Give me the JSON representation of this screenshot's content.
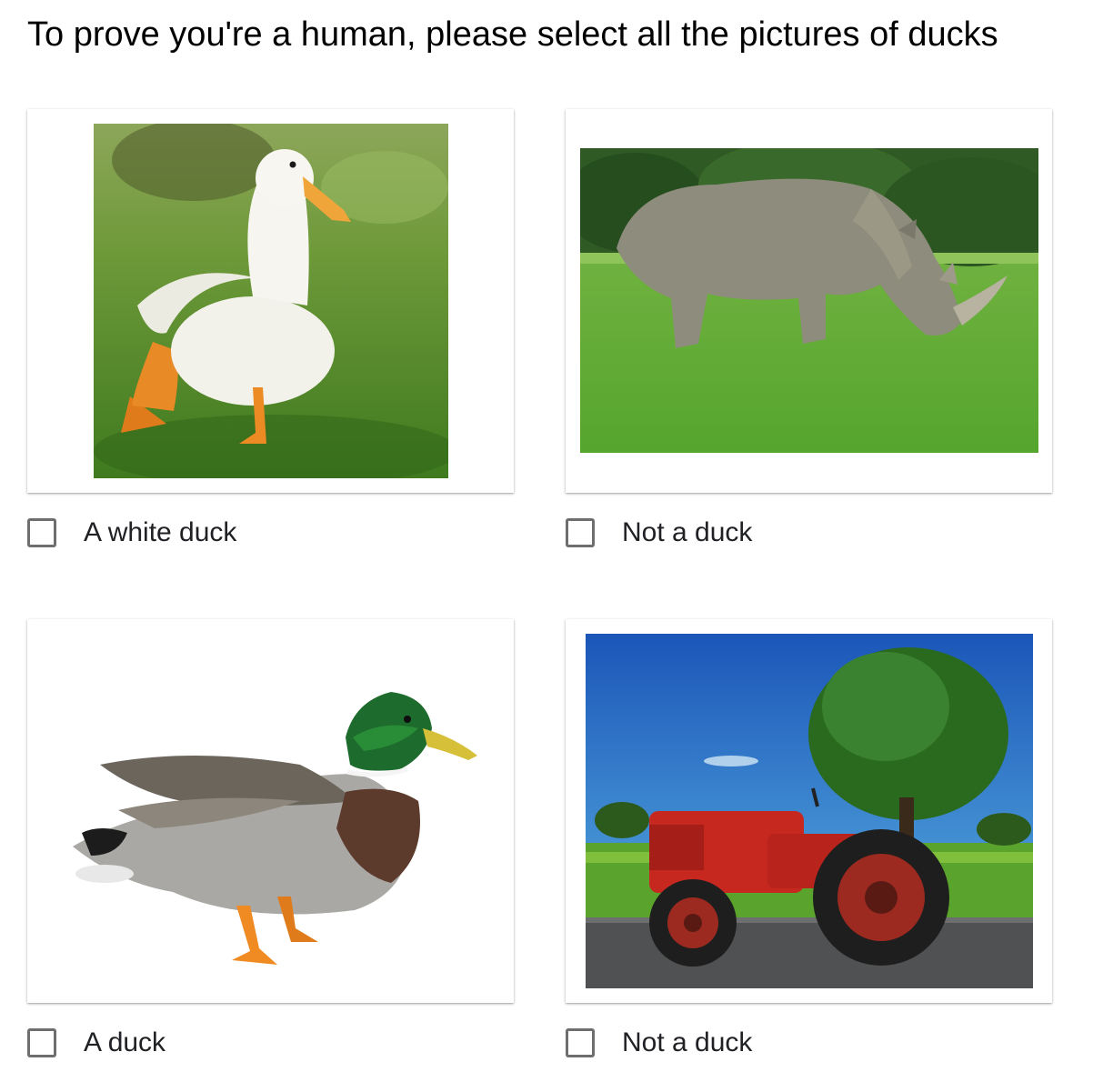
{
  "prompt": {
    "title": "To prove you're a human, please select all the pictures of ducks"
  },
  "options": [
    {
      "label": "A white duck",
      "image_icon": "white-duck-photo",
      "checked": false
    },
    {
      "label": "Not a duck",
      "image_icon": "rhinoceros-photo",
      "checked": false
    },
    {
      "label": "A duck",
      "image_icon": "mallard-duck-photo",
      "checked": false
    },
    {
      "label": "Not a duck",
      "image_icon": "red-tractor-photo",
      "checked": false
    }
  ],
  "colors": {
    "checkbox_border": "#6e6e6e",
    "text": "#202124",
    "card_background": "#ffffff"
  }
}
